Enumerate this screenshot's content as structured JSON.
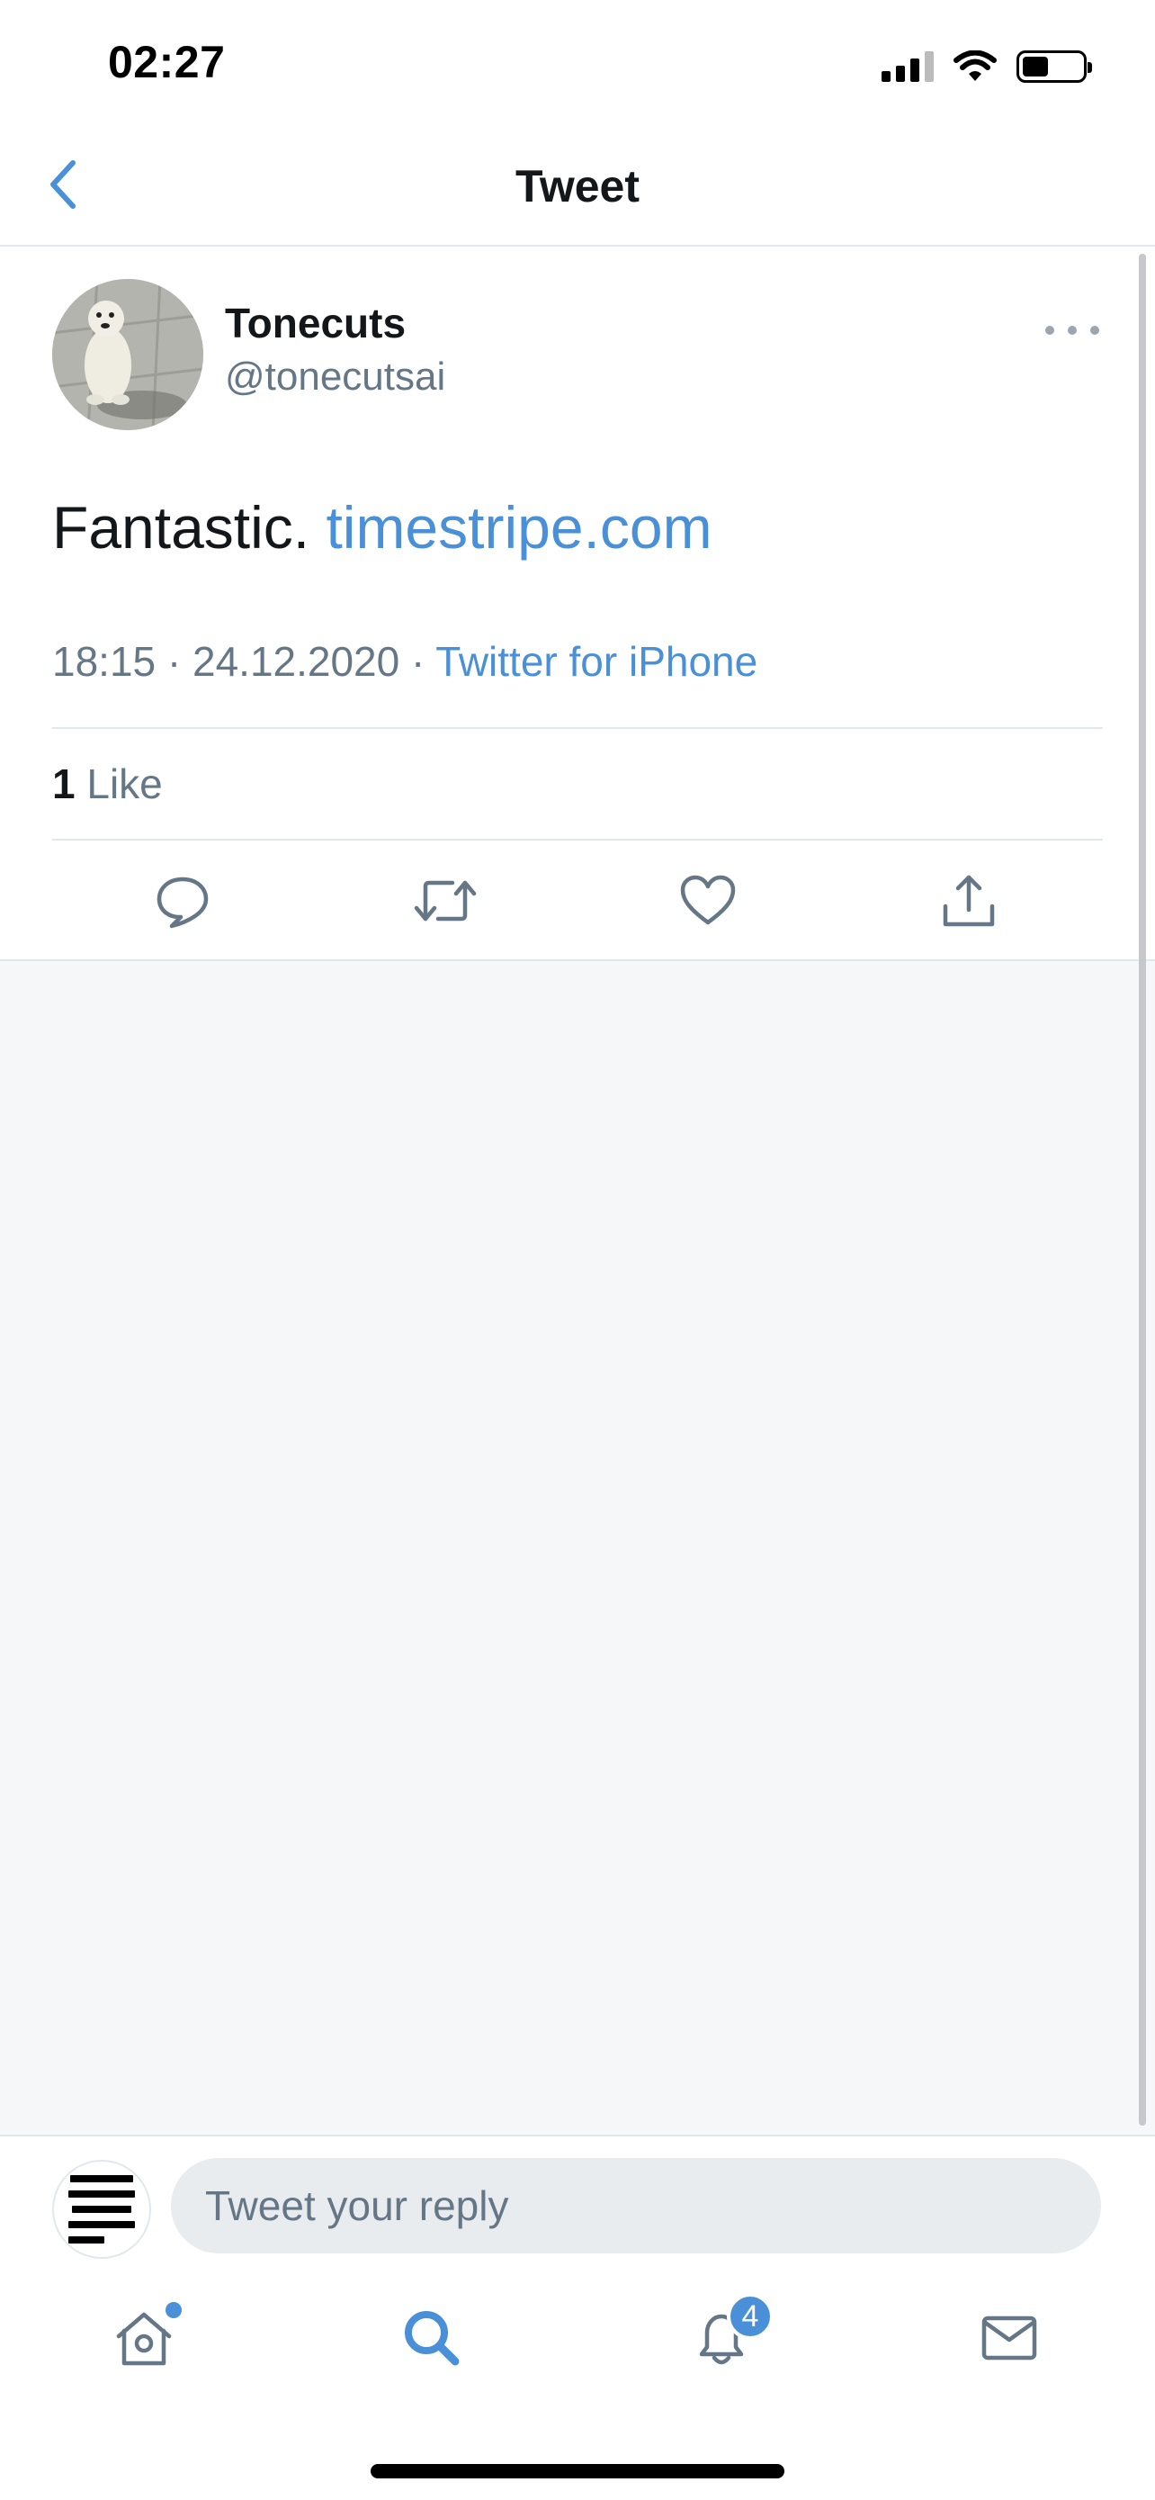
{
  "status_bar": {
    "time": "02:27",
    "battery_level": 0.44
  },
  "nav": {
    "title": "Tweet"
  },
  "tweet": {
    "author": {
      "display_name": "Tonecuts",
      "handle": "@tonecutsai"
    },
    "text": "Fantastic.",
    "link": "timestripe.com",
    "timestamp": "18:15 · 24.12.2020 ·",
    "source": "Twitter for iPhone",
    "likes_count": "1",
    "likes_label": "Like"
  },
  "reply": {
    "placeholder": "Tweet your reply"
  },
  "tab_bar": {
    "tabs": [
      {
        "name": "home",
        "icon": "home-icon"
      },
      {
        "name": "search",
        "icon": "search-icon"
      },
      {
        "name": "notifications",
        "icon": "bell-icon",
        "badge": "4"
      },
      {
        "name": "messages",
        "icon": "mail-icon"
      }
    ],
    "notifications_badge": "4"
  },
  "colors": {
    "accent": "#4a90d9",
    "secondary_text": "#657786",
    "divider": "#e1e8ed",
    "background_gray": "#f5f7f9"
  }
}
